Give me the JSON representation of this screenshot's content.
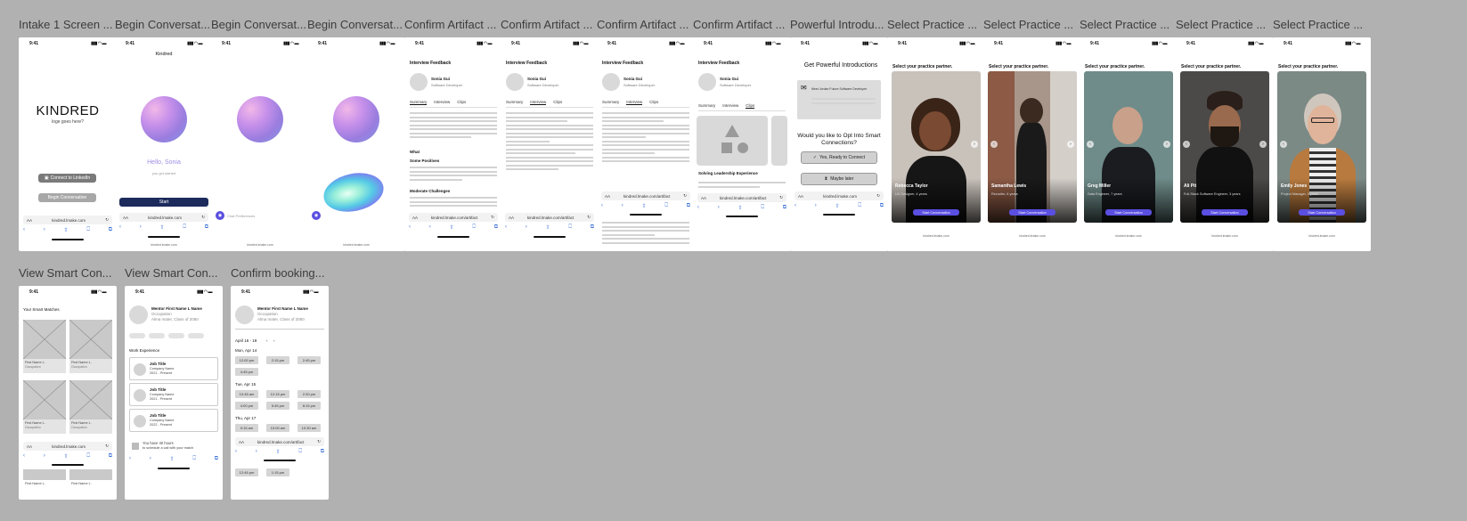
{
  "labels": [
    "Intake 1 Screen ...",
    "Begin Conversat...",
    "Begin Conversat...",
    "Begin Conversat...",
    "Confirm Artifact ...",
    "Confirm Artifact ...",
    "Confirm Artifact ...",
    "Confirm Artifact ...",
    "Powerful Introdu...",
    "Select Practice ...",
    "Select Practice ...",
    "Select Practice ...",
    "Select Practice ...",
    "Select Practice ...",
    "View Smart Con...",
    "View Smart Con...",
    "Confirm booking..."
  ],
  "status": {
    "time": "9:41",
    "signal": "▮▮▮ ◠ ▬"
  },
  "browser": {
    "aa": "AA",
    "url_main": "kindred.lmake.com",
    "url_artifact": "kindred.lmake.com/artifact",
    "footer": "kindred.lmake.com",
    "reload": "↻",
    "lock": "🔒"
  },
  "nav": {
    "back": "‹",
    "forward": "›",
    "share": "⇧",
    "book": "⎕",
    "tabs": "⧉"
  },
  "intake": {
    "logo": "KINDRED",
    "tagline": "loge goes here?",
    "linkedin": "Connect to LinkedIn",
    "begin": "Begin Conversation"
  },
  "begin1": {
    "title": "Kindred",
    "hello": "Hello, Sonia",
    "sub": "you got started",
    "start": "Start"
  },
  "begin2": {
    "chat": "Chat Preferences"
  },
  "artifact": {
    "title": "Interview Feedback",
    "name": "Sonia Gui",
    "role": "Software Developer",
    "tab_summary": "Summary",
    "tab_interview": "Interview",
    "tab_clips": "Clips",
    "what": "What",
    "strong": "Some Positives",
    "moderate": "Moderate Challenges",
    "leadership": "Solving Leadership Experience"
  },
  "intro": {
    "title": "Get Powerful Introductions",
    "card_text": "Meet Jordan Future Software Developer",
    "question": "Would you like to Opt Into Smart Connections?",
    "yes": "Yes, Ready to Connect",
    "maybe": "Maybe later"
  },
  "practice": {
    "heading": "Select your practice partner.",
    "cta": "Start Conversation",
    "people": [
      {
        "name": "Rebecca Taylor",
        "desc": "UX Designer, 4 years",
        "color": "#c9c2bb"
      },
      {
        "name": "Samantha Lewis",
        "desc": "Recruiter, 6 years",
        "color": "#a8968a"
      },
      {
        "name": "Greg Miller",
        "desc": "Data Engineer, 7 years",
        "color": "#6f8c8a"
      },
      {
        "name": "Ali Pit",
        "desc": "Full-Stack Software Engineer, 3 years",
        "color": "#4c4a48"
      },
      {
        "name": "Emily Jones",
        "desc": "Project Manager, 5 years",
        "color": "#7c8a86"
      }
    ]
  },
  "smart": {
    "title": "Your Smart Matches",
    "first": "First Name L.",
    "occ": "Occupation"
  },
  "mentor": {
    "name": "Mentor First Name L Name",
    "occ": "Occupation",
    "alma": "Alma mater, Class of 2050",
    "work": "Work Experience",
    "job": "Job Title",
    "company": "Company Name",
    "dates1": "2021 - Present",
    "dates2": "2021 - Present",
    "dates3": "2022 - Present",
    "hours": "You have 40 hours",
    "hours_sub": "to schedule a call with your match"
  },
  "booking": {
    "range": "April 16 - 19",
    "day1": "Mon, Apr 14",
    "day2": "Tue, Apr 15",
    "day3": "Thu, Apr 17",
    "s1": "12:00 pm",
    "s2": "2:15 pm",
    "s3": "2:45 pm",
    "s4": "4:45 pm",
    "s5": "10:45 am",
    "s6": "12:15 pm",
    "s7": "2:30 pm",
    "s8": "4:00 pm",
    "s9": "5:45 pm",
    "s10": "8:15 pm",
    "s11": "9:15 am",
    "s12": "10:00 am",
    "s13": "10:30 am",
    "s14": "12:45 pm",
    "s15": "1:15 pm"
  }
}
